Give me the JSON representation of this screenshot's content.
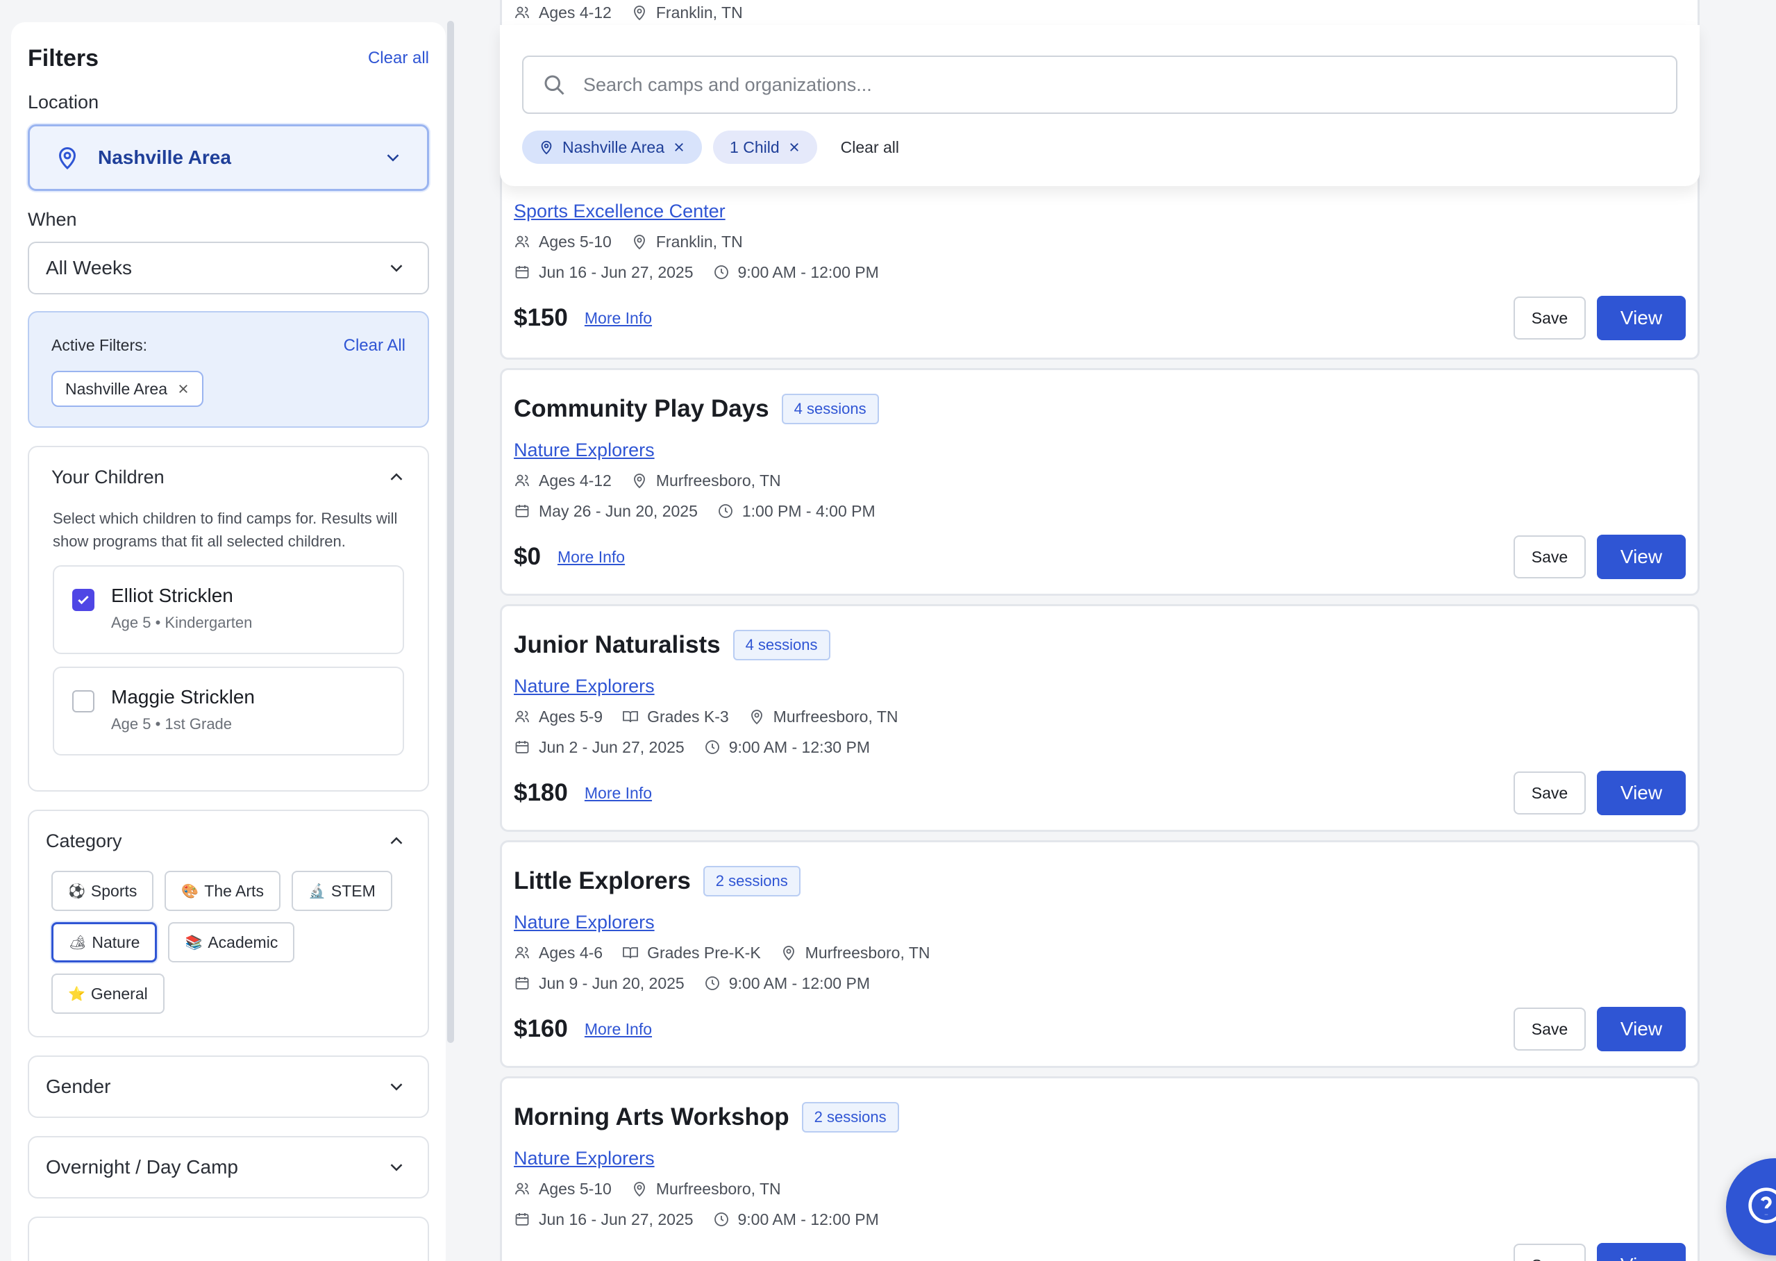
{
  "filters": {
    "title": "Filters",
    "clear_all": "Clear all",
    "location_label": "Location",
    "location_value": "Nashville Area",
    "when_label": "When",
    "when_value": "All Weeks",
    "active": {
      "label": "Active Filters:",
      "clear": "Clear All",
      "chips": [
        "Nashville Area"
      ]
    },
    "children": {
      "title": "Your Children",
      "description": "Select which children to find camps for. Results will show programs that fit all selected children.",
      "items": [
        {
          "name": "Elliot Stricklen",
          "meta": "Age 5 • Kindergarten",
          "checked": true
        },
        {
          "name": "Maggie Stricklen",
          "meta": "Age 5 • 1st Grade",
          "checked": false
        }
      ]
    },
    "category": {
      "title": "Category",
      "items": [
        {
          "emoji": "⚽",
          "label": "Sports",
          "selected": false
        },
        {
          "emoji": "🎨",
          "label": "The Arts",
          "selected": false
        },
        {
          "emoji": "🔬",
          "label": "STEM",
          "selected": false
        },
        {
          "emoji": "🏕",
          "label": "Nature",
          "selected": true
        },
        {
          "emoji": "📚",
          "label": "Academic",
          "selected": false
        },
        {
          "emoji": "⭐",
          "label": "General",
          "selected": false
        }
      ]
    },
    "gender_title": "Gender",
    "overnight_title": "Overnight / Day Camp"
  },
  "search": {
    "placeholder": "Search camps and organizations...",
    "pills": [
      "Nashville Area",
      "1 Child"
    ],
    "clear_all": "Clear all"
  },
  "top_peek": {
    "ages": "Ages 4-12",
    "location": "Franklin, TN"
  },
  "camps": [
    {
      "org": "Sports Excellence Center",
      "ages": "Ages 5-10",
      "location": "Franklin, TN",
      "dates": "Jun 16 - Jun 27, 2025",
      "time": "9:00 AM - 12:00 PM",
      "price": "$150"
    },
    {
      "title": "Community Play Days",
      "sessions": "4 sessions",
      "org": "Nature Explorers",
      "ages": "Ages 4-12",
      "location": "Murfreesboro, TN",
      "dates": "May 26 - Jun 20, 2025",
      "time": "1:00 PM - 4:00 PM",
      "price": "$0"
    },
    {
      "title": "Junior Naturalists",
      "sessions": "4 sessions",
      "org": "Nature Explorers",
      "ages": "Ages 5-9",
      "grades": "Grades K-3",
      "location": "Murfreesboro, TN",
      "dates": "Jun 2 - Jun 27, 2025",
      "time": "9:00 AM - 12:30 PM",
      "price": "$180"
    },
    {
      "title": "Little Explorers",
      "sessions": "2 sessions",
      "org": "Nature Explorers",
      "ages": "Ages 4-6",
      "grades": "Grades Pre-K-K",
      "location": "Murfreesboro, TN",
      "dates": "Jun 9 - Jun 20, 2025",
      "time": "9:00 AM - 12:00 PM",
      "price": "$160"
    },
    {
      "title": "Morning Arts Workshop",
      "sessions": "2 sessions",
      "org": "Nature Explorers",
      "ages": "Ages 5-10",
      "location": "Murfreesboro, TN",
      "dates": "Jun 16 - Jun 27, 2025",
      "time": "9:00 AM - 12:00 PM"
    }
  ],
  "labels": {
    "more_info": "More Info",
    "save": "Save",
    "view": "View"
  },
  "colors": {
    "accent": "#2f55d4",
    "checkbox": "#4f46e5",
    "badge_bg": "#edf3fd"
  }
}
